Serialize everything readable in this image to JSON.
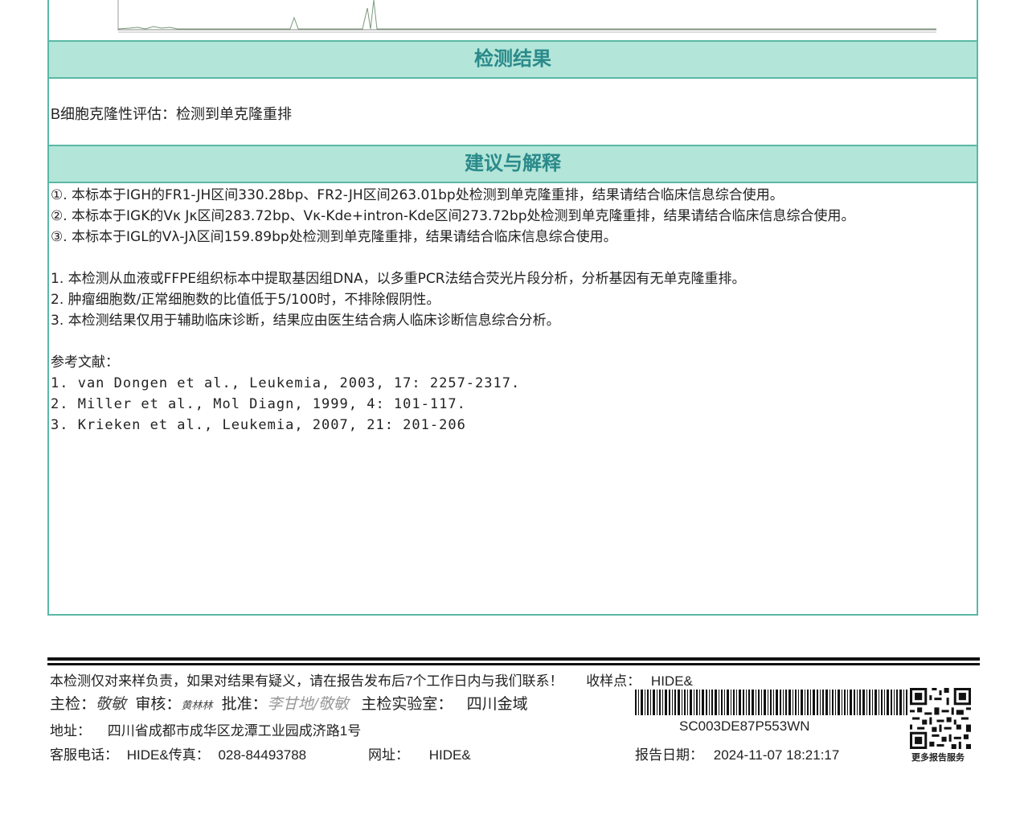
{
  "result_section": {
    "title": "检测结果",
    "label": "B细胞克隆性评估：",
    "value": "检测到单克隆重排"
  },
  "advice_section": {
    "title": "建议与解释",
    "findings": [
      "①. 本标本于IGH的FR1-JH区间330.28bp、FR2-JH区间263.01bp处检测到单克隆重排，结果请结合临床信息综合使用。",
      "②. 本标本于IGK的Vκ Jκ区间283.72bp、Vκ-Kde+intron-Kde区间273.72bp处检测到单克隆重排，结果请结合临床信息综合使用。",
      "③. 本标本于IGL的Vλ-Jλ区间159.89bp处检测到单克隆重排，结果请结合临床信息综合使用。"
    ],
    "notes": [
      "1. 本检测从血液或FFPE组织标本中提取基因组DNA，以多重PCR法结合荧光片段分析，分析基因有无单克隆重排。",
      "2. 肿瘤细胞数/正常细胞数的比值低于5/100时，不排除假阴性。",
      "3. 本检测结果仅用于辅助临床诊断，结果应由医生结合病人临床诊断信息综合分析。"
    ],
    "references_title": "参考文献：",
    "references": [
      "1. van Dongen et al., Leukemia, 2003, 17: 2257-2317.",
      "2. Miller et al., Mol Diagn, 1999, 4: 101-117.",
      "3. Krieken et al., Leukemia, 2007, 21: 201-206"
    ]
  },
  "footer": {
    "disclaimer": "本检测仅对来样负责，如果对结果有疑义，请在报告发布后7个工作日内与我们联系！",
    "collection_label": "收样点：",
    "collection_value": "HIDE&",
    "inspector_label": "主检：",
    "inspector_sig": "敬敏",
    "reviewer_label": "审核：",
    "reviewer_sig": "黄林林",
    "approver_label": "批准：",
    "approver_sig": "李甘地/敬敏",
    "lab_label": "主检实验室：",
    "lab_value": "四川金域",
    "address_label": "地址：",
    "address_value": "四川省成都市成华区龙潭工业园成济路1号",
    "phone_label": "客服电话：",
    "phone_value": "HIDE&",
    "fax_label": "传真：",
    "fax_value": "028-84493788",
    "website_label": "网址：",
    "website_value": "HIDE&",
    "barcode_text": "SC003DE87P553WN",
    "report_date_label": "报告日期：",
    "report_date_value": "2024-11-07 18:21:17",
    "qr_caption": "更多报告服务"
  }
}
